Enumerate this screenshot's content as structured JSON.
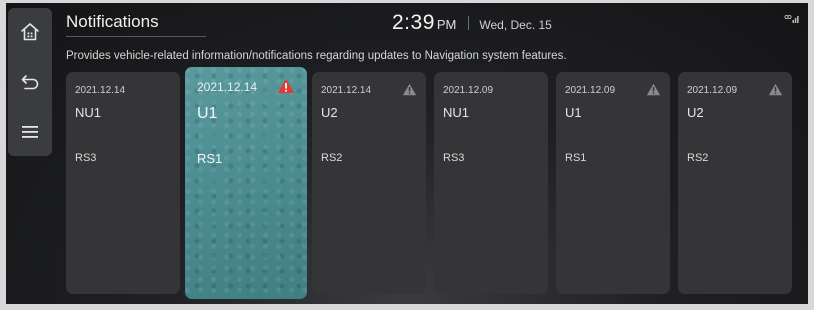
{
  "header": {
    "title": "Notifications",
    "time": "2:39",
    "ampm": "PM",
    "date": "Wed, Dec. 15"
  },
  "subtitle": "Provides vehicle-related information/notifications regarding updates to Navigation system features.",
  "sidebar": {
    "items": [
      {
        "name": "home-icon"
      },
      {
        "name": "back-icon"
      },
      {
        "name": "menu-icon"
      }
    ]
  },
  "cards": [
    {
      "date": "2021.12.14",
      "type": "NU1",
      "rs": "RS3",
      "warning": false,
      "selected": false
    },
    {
      "date": "2021.12.14",
      "type": "U1",
      "rs": "RS1",
      "warning": true,
      "selected": true
    },
    {
      "date": "2021.12.14",
      "type": "U2",
      "rs": "RS2",
      "warning": true,
      "selected": false
    },
    {
      "date": "2021.12.09",
      "type": "NU1",
      "rs": "RS3",
      "warning": false,
      "selected": false
    },
    {
      "date": "2021.12.09",
      "type": "U1",
      "rs": "RS1",
      "warning": true,
      "selected": false
    },
    {
      "date": "2021.12.09",
      "type": "U2",
      "rs": "RS2",
      "warning": true,
      "selected": false
    }
  ],
  "colors": {
    "accent_selected": "#4d8f93",
    "warning_active": "#e53935",
    "warning_inactive": "#8a8a8c",
    "card_bg": "#353538"
  }
}
